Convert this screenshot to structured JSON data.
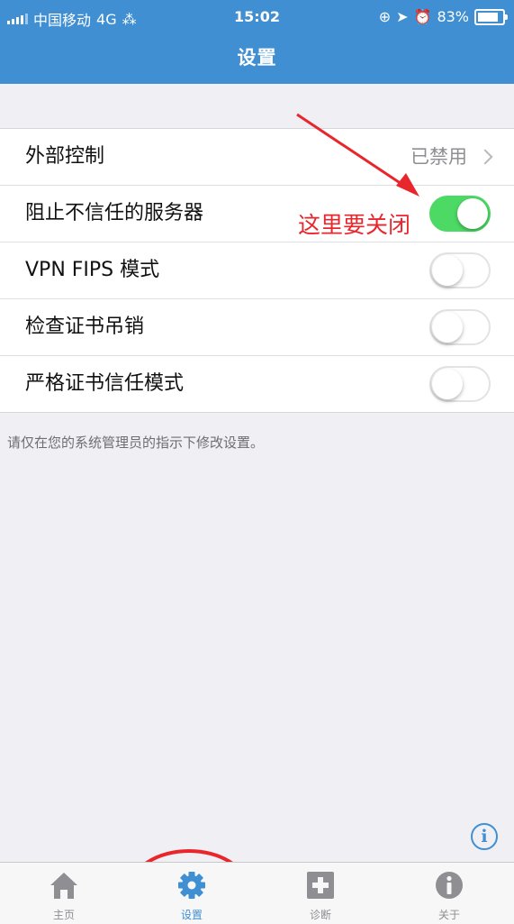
{
  "status_bar": {
    "carrier": "中国移动",
    "network": "4G",
    "time": "15:02",
    "battery": "83%",
    "battery_level": 0.83
  },
  "header": {
    "title": "设置"
  },
  "settings": {
    "external_control": {
      "label": "外部控制",
      "value": "已禁用"
    },
    "block_untrusted": {
      "label": "阻止不信任的服务器",
      "enabled": true
    },
    "vpn_fips": {
      "label": "VPN FIPS 模式",
      "enabled": false
    },
    "check_revocation": {
      "label": "检查证书吊销",
      "enabled": false
    },
    "strict_trust": {
      "label": "严格证书信任模式",
      "enabled": false
    }
  },
  "footer_note": "请仅在您的系统管理员的指示下修改设置。",
  "annotation": {
    "text": "这里要关闭",
    "color": "#e8262c"
  },
  "tabs": [
    {
      "label": "主页",
      "icon": "home-icon",
      "active": false
    },
    {
      "label": "设置",
      "icon": "gear-icon",
      "active": true
    },
    {
      "label": "诊断",
      "icon": "plus-box-icon",
      "active": false
    },
    {
      "label": "关于",
      "icon": "info-icon",
      "active": false
    }
  ],
  "colors": {
    "accent": "#3f8fd2",
    "toggle_on": "#4cd964"
  }
}
